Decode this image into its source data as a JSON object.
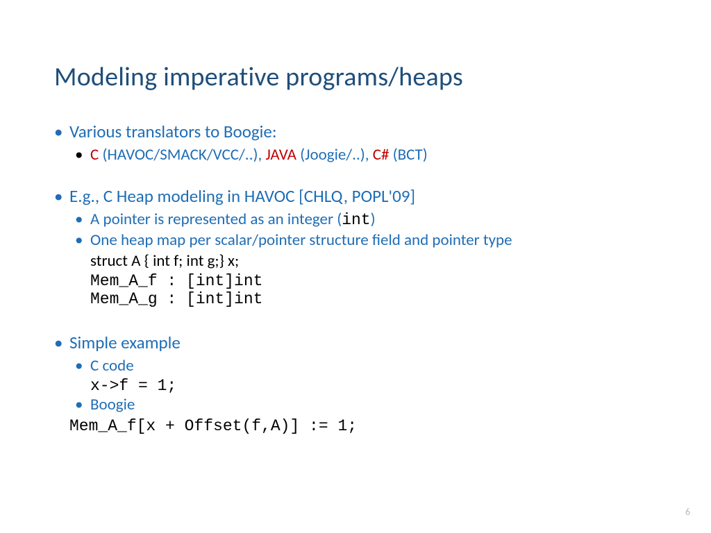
{
  "title": "Modeling imperative programs/heaps",
  "bullet1": {
    "text": "Various translators to Boogie:",
    "sub": {
      "c_label": "C",
      "c_rest": " (HAVOC/SMACK/VCC/..), ",
      "java_label": "JAVA",
      "java_rest": " (Joogie/..), ",
      "cs_label": "C#",
      "cs_rest": " (BCT)"
    }
  },
  "bullet2": {
    "text": "E.g., C Heap modeling in HAVOC [CHLQ, POPL'09]",
    "sub1_pre": "A pointer is represented as an integer (",
    "sub1_code": "int",
    "sub1_post": ")",
    "sub2": "One heap map per scalar/pointer structure field and pointer type",
    "struct_decl": "struct  A { int f; int g;} x;",
    "mem1": "Mem_A_f : [int]int",
    "mem2": "Mem_A_g : [int]int"
  },
  "bullet3": {
    "text": "Simple example",
    "ccode_label": "C code",
    "ccode": "x->f = 1;",
    "boogie_label": "Boogie",
    "boogie": "Mem_A_f[x + Offset(f,A)] := 1;"
  },
  "page_number": "6"
}
